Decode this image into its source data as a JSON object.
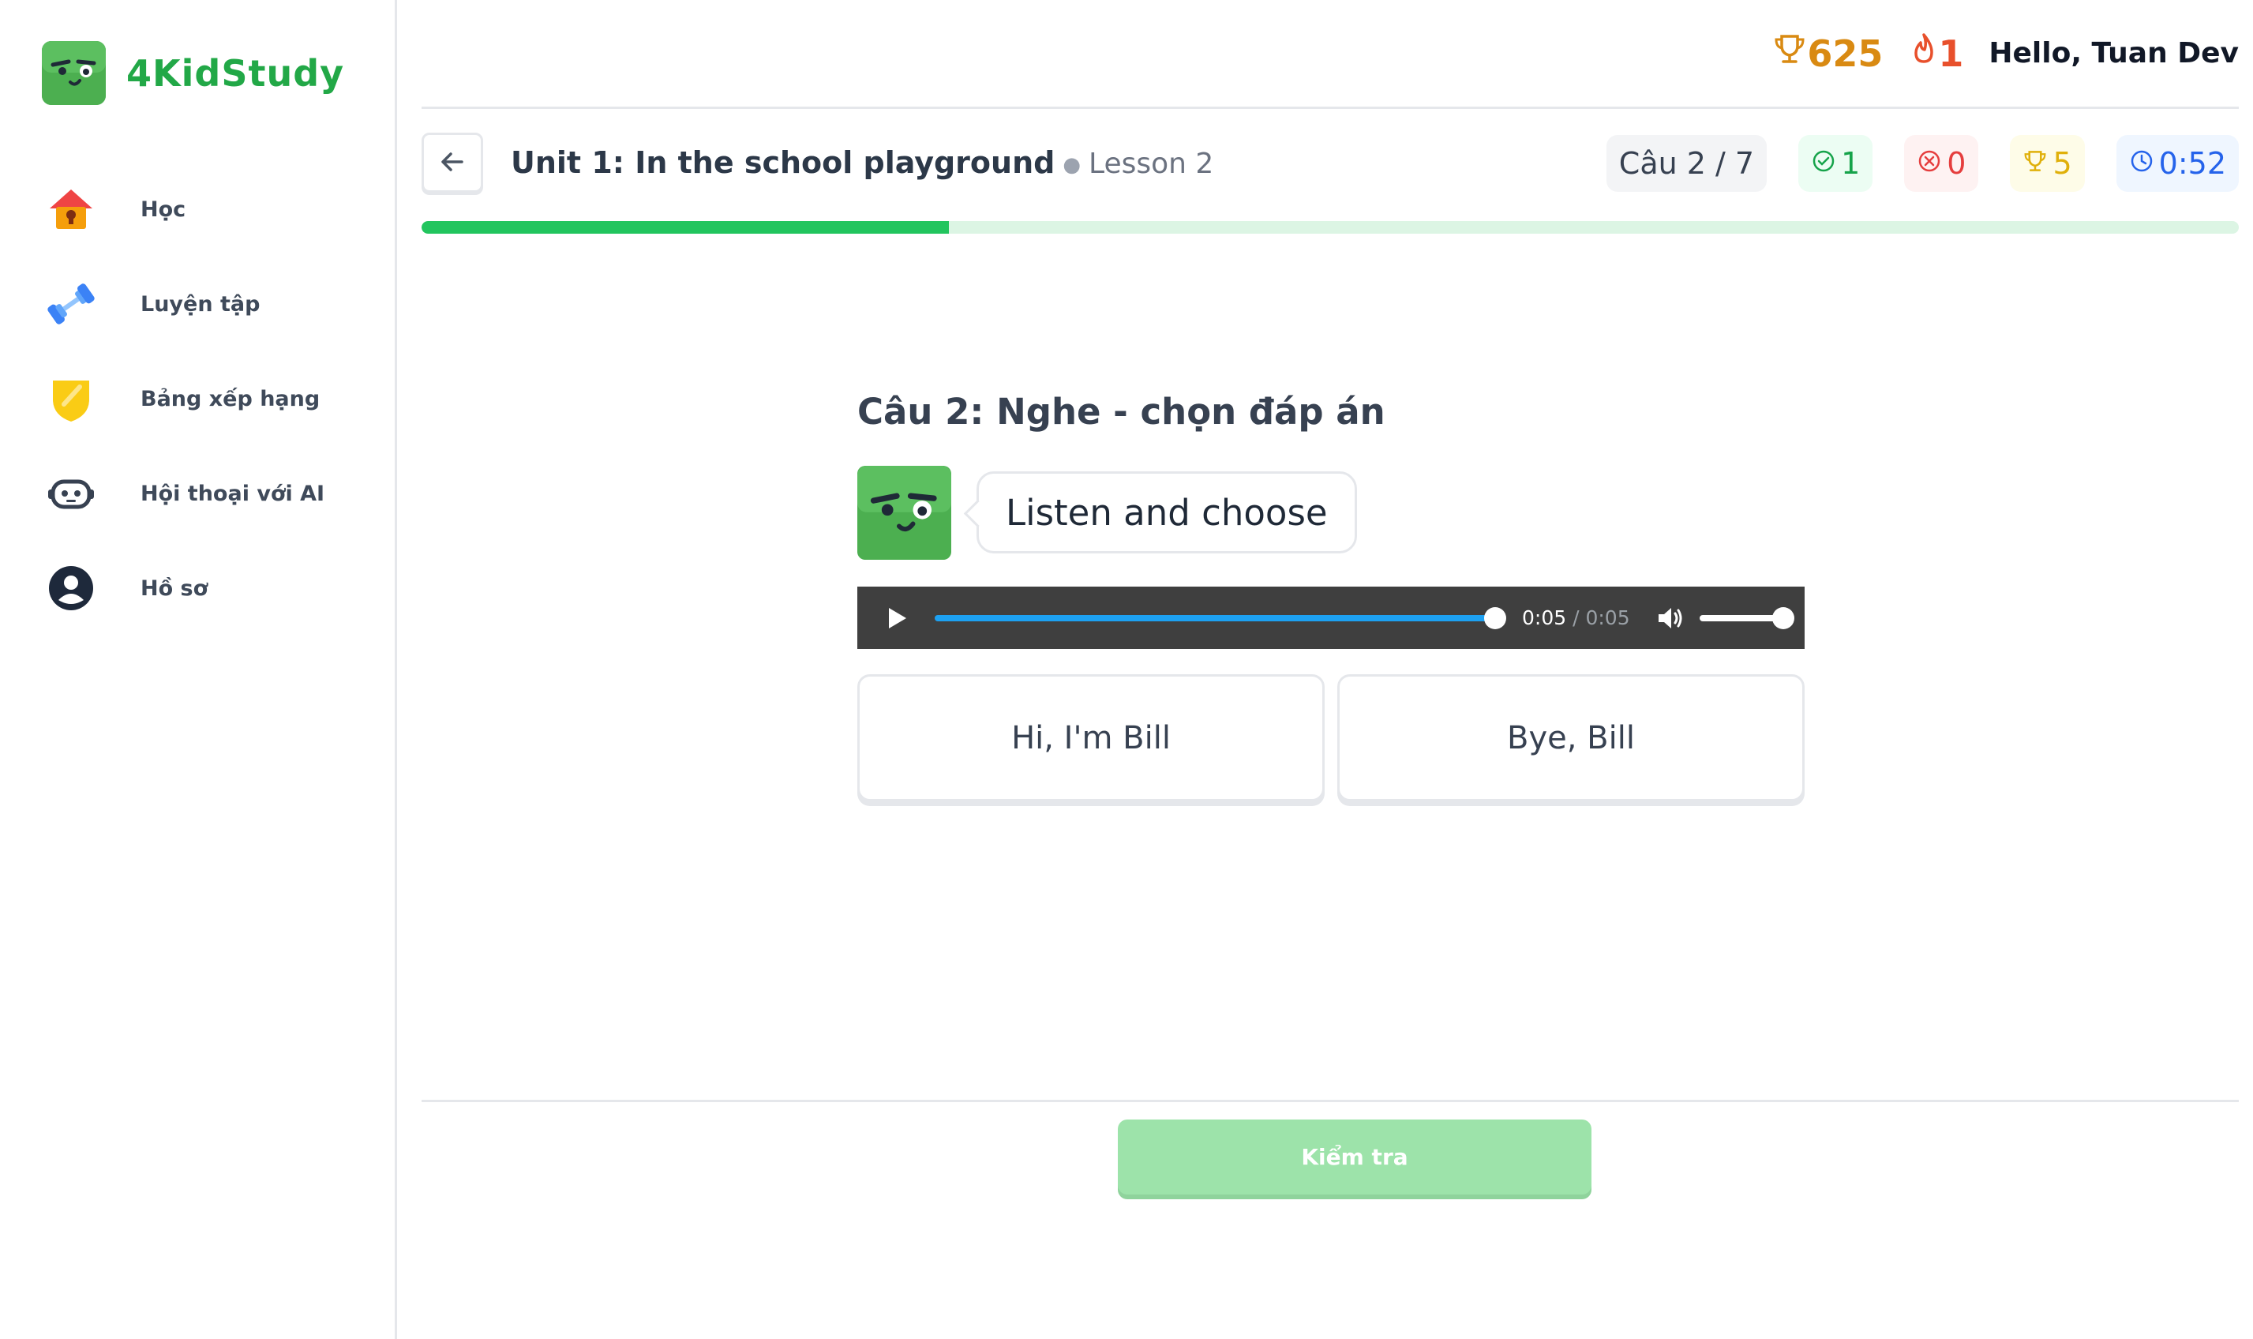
{
  "brand": {
    "name": "4KidStudy"
  },
  "sidebar": {
    "items": [
      {
        "label": "Học",
        "icon": "home-icon"
      },
      {
        "label": "Luyện tập",
        "icon": "dumbbell-icon"
      },
      {
        "label": "Bảng xếp hạng",
        "icon": "shield-icon"
      },
      {
        "label": "Hội thoại với AI",
        "icon": "robot-icon"
      },
      {
        "label": "Hồ sơ",
        "icon": "user-icon"
      }
    ]
  },
  "header": {
    "points": "625",
    "streak": "1",
    "greeting": "Hello, Tuan Dev"
  },
  "lesson": {
    "unit_title": "Unit 1: In the school playground",
    "lesson_label": "Lesson 2",
    "question_counter": "Câu 2 / 7",
    "correct_count": "1",
    "wrong_count": "0",
    "score": "5",
    "timer": "0:52",
    "progress_fraction": 0.29
  },
  "question": {
    "title": "Câu 2: Nghe - chọn đáp án",
    "prompt": "Listen and choose",
    "audio": {
      "current": "0:05",
      "duration": "0:05",
      "played_fraction": 1.0
    },
    "answers": [
      "Hi, I'm Bill",
      "Bye, Bill"
    ]
  },
  "footer": {
    "check_label": "Kiểm tra"
  },
  "colors": {
    "brand": "#22a847",
    "progress": "#22c55e",
    "check_disabled": "#9de3aa",
    "points": "#d98a12",
    "streak": "#e8502c"
  }
}
